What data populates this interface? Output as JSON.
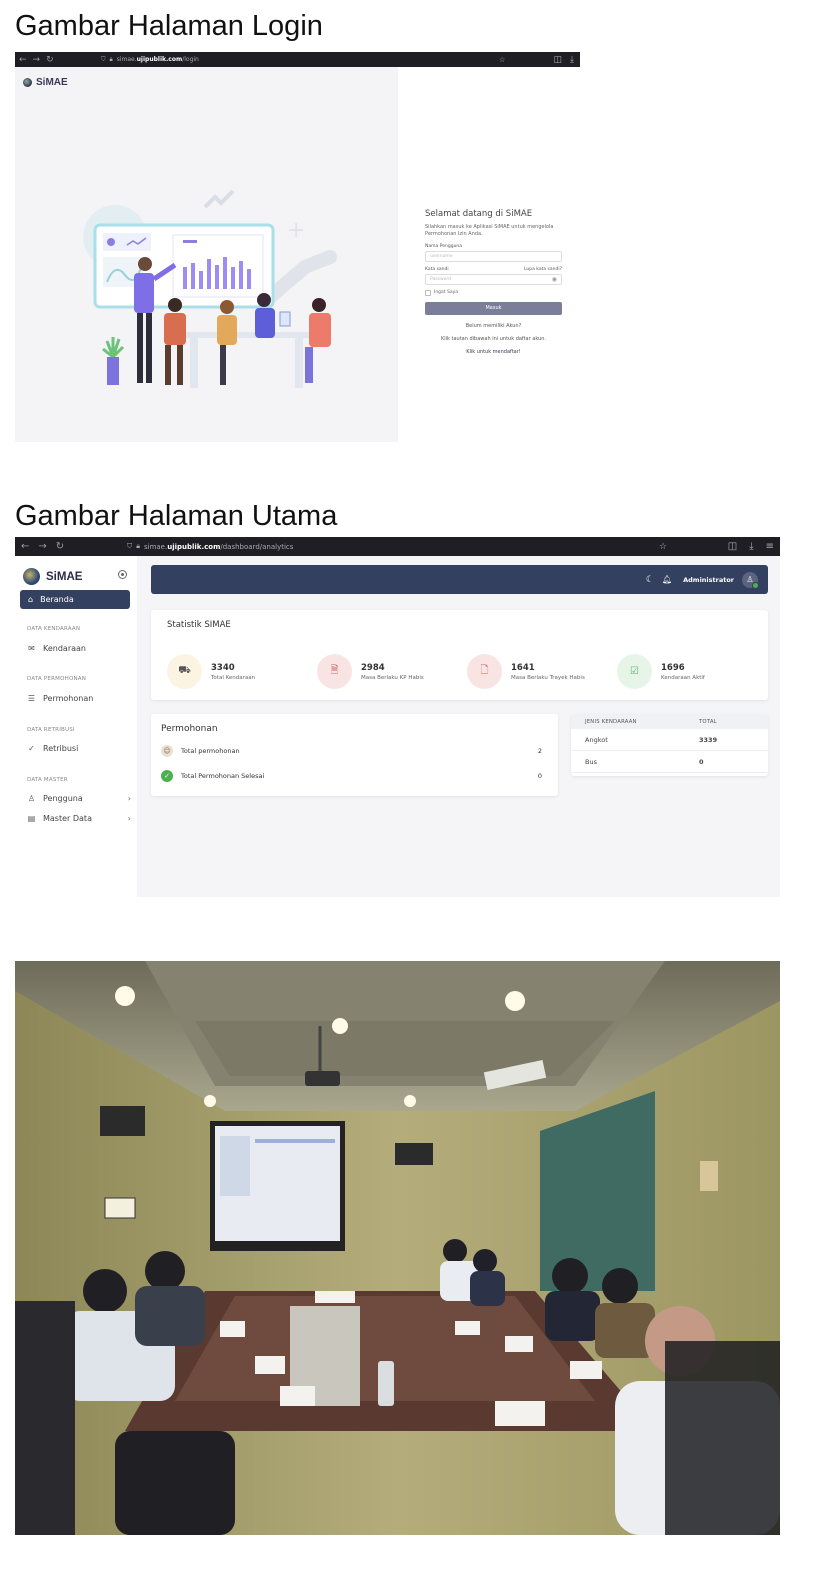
{
  "headings": {
    "login": "Gambar Halaman Login",
    "main": "Gambar Halaman Utama"
  },
  "login_shot": {
    "url_prefix": "simae.",
    "url_domain": "ujipublik.com",
    "url_path": "/login",
    "brand": "SiMAE",
    "form": {
      "title": "Selamat datang di SiMAE",
      "description": "Silahkan masuk ke Aplikasi SiMAE untuk mengelola Permohonan Izin Anda.",
      "username_label": "Nama Pengguna",
      "username_placeholder": "username",
      "password_label": "Kata sandi",
      "forgot_link": "Lupa kata sandi?",
      "password_placeholder": "Password",
      "remember_label": "Ingat Saya",
      "submit_label": "Masuk",
      "no_account": "Belum memiliki Akun?",
      "hint": "Klik tautan dibawah ini untuk daftar akun.",
      "register_link": "Klik untuk mendaftar!"
    }
  },
  "dashboard_shot": {
    "url_prefix": "simae.",
    "url_domain": "ujipublik.com",
    "url_path": "/dashboard/analytics",
    "brand": "SiMAE",
    "sidebar": {
      "active_item": "Beranda",
      "sections": [
        {
          "title": "DATA KENDARAAN",
          "items": [
            {
              "label": "Kendaraan",
              "icon": "mail-icon"
            }
          ]
        },
        {
          "title": "DATA PERMOHONAN",
          "items": [
            {
              "label": "Permohonan",
              "icon": "server-icon"
            }
          ]
        },
        {
          "title": "DATA RETRIBUSI",
          "items": [
            {
              "label": "Retribusi",
              "icon": "check-icon"
            }
          ]
        },
        {
          "title": "DATA MASTER",
          "items": [
            {
              "label": "Pengguna",
              "icon": "user-icon"
            },
            {
              "label": "Master Data",
              "icon": "table-icon"
            }
          ]
        }
      ]
    },
    "topbar": {
      "user_name": "Administrator"
    },
    "statistics": {
      "title": "Statistik SIMAE",
      "items": [
        {
          "value": "3340",
          "label": "Total Kendaraan",
          "icon": "truck-icon",
          "bg": "#fbf4e3",
          "fg": "#555"
        },
        {
          "value": "2984",
          "label": "Masa Berlaku KP Habis",
          "icon": "document-icon",
          "bg": "#f9e4e4",
          "fg": "#c96060"
        },
        {
          "value": "1641",
          "label": "Masa Berlaku Trayek Habis",
          "icon": "file-icon",
          "bg": "#f9e4e4",
          "fg": "#c96060"
        },
        {
          "value": "1696",
          "label": "Kendaraan Aktif",
          "icon": "check-square-icon",
          "bg": "#e6f5e8",
          "fg": "#5bb36a"
        }
      ]
    },
    "permohonan": {
      "title": "Permohonan",
      "rows": [
        {
          "label": "Total permohonan",
          "value": "2"
        },
        {
          "label": "Total Permohonan Selesai",
          "value": "0"
        }
      ]
    },
    "jenis_table": {
      "headers": [
        "JENIS KENDARAAN",
        "TOTAL"
      ],
      "rows": [
        [
          "Angkot",
          "3339"
        ],
        [
          "Bus",
          "0"
        ]
      ]
    }
  },
  "photo": {
    "description_icon": "meeting-room-photo"
  }
}
